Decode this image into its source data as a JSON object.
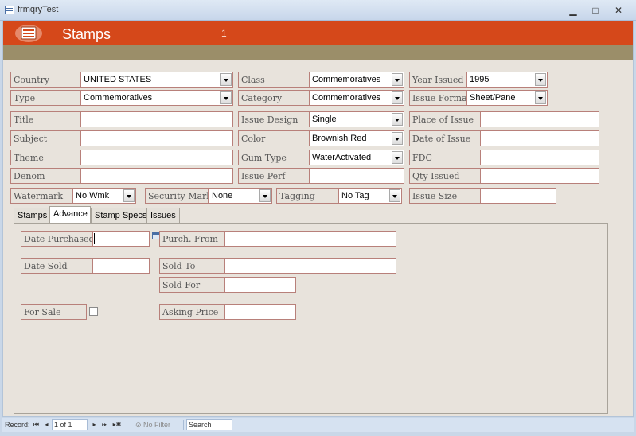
{
  "window": {
    "title": "frmqryTest",
    "min_glyph": "▁",
    "max_glyph": "□",
    "close_glyph": "✕"
  },
  "header": {
    "title": "Stamps",
    "record_number": "1",
    "colors": {
      "banner": "#d5481a",
      "subbanner": "#9b8e69"
    }
  },
  "fields": {
    "country": {
      "label": "Country",
      "value": "UNITED STATES"
    },
    "class": {
      "label": "Class",
      "value": "Commemoratives"
    },
    "year_issued": {
      "label": "Year Issued",
      "value": "1995"
    },
    "type": {
      "label": "Type",
      "value": "Commemoratives"
    },
    "category": {
      "label": "Category",
      "value": "Commemoratives"
    },
    "issue_format": {
      "label": "Issue Format",
      "value": "Sheet/Pane"
    },
    "title": {
      "label": "Title",
      "value": ""
    },
    "issue_design": {
      "label": "Issue Design",
      "value": "Single"
    },
    "place_of_issue": {
      "label": "Place of Issue",
      "value": ""
    },
    "subject": {
      "label": "Subject",
      "value": ""
    },
    "color": {
      "label": "Color",
      "value": "Brownish Red"
    },
    "date_of_issue": {
      "label": "Date of Issue",
      "value": ""
    },
    "theme": {
      "label": "Theme",
      "value": ""
    },
    "gum_type": {
      "label": "Gum Type",
      "value": "WaterActivated"
    },
    "fdc": {
      "label": "FDC",
      "value": ""
    },
    "denom": {
      "label": "Denom",
      "value": ""
    },
    "issue_perf": {
      "label": "Issue Perf",
      "value": ""
    },
    "qty_issued": {
      "label": "Qty Issued",
      "value": ""
    },
    "watermark": {
      "label": "Watermark",
      "value": "No Wmk"
    },
    "security_mark": {
      "label": "Security Mark",
      "value": "None"
    },
    "tagging": {
      "label": "Tagging",
      "value": "No Tag"
    },
    "issue_size": {
      "label": "Issue Size",
      "value": ""
    }
  },
  "tabs": [
    {
      "label": "Stamps",
      "active": false
    },
    {
      "label": "Advance",
      "active": true
    },
    {
      "label": "Stamp Specs",
      "active": false
    },
    {
      "label": "Issues",
      "active": false
    }
  ],
  "advance": {
    "date_purchased": {
      "label": "Date Purchased",
      "value": ""
    },
    "purch_from": {
      "label": "Purch. From",
      "value": ""
    },
    "date_sold": {
      "label": "Date Sold",
      "value": ""
    },
    "sold_to": {
      "label": "Sold To",
      "value": ""
    },
    "sold_for": {
      "label": "Sold For",
      "value": ""
    },
    "for_sale": {
      "label": "For Sale",
      "checked": false
    },
    "asking_price": {
      "label": "Asking Price",
      "value": ""
    }
  },
  "navbar": {
    "record_label": "Record:",
    "position": "1 of 1",
    "first_glyph": "⏮",
    "prev_glyph": "◂",
    "next_glyph": "▸",
    "last_glyph": "⏭",
    "new_glyph": "▸✱",
    "filter_label": "No Filter",
    "search_label": "Search"
  }
}
